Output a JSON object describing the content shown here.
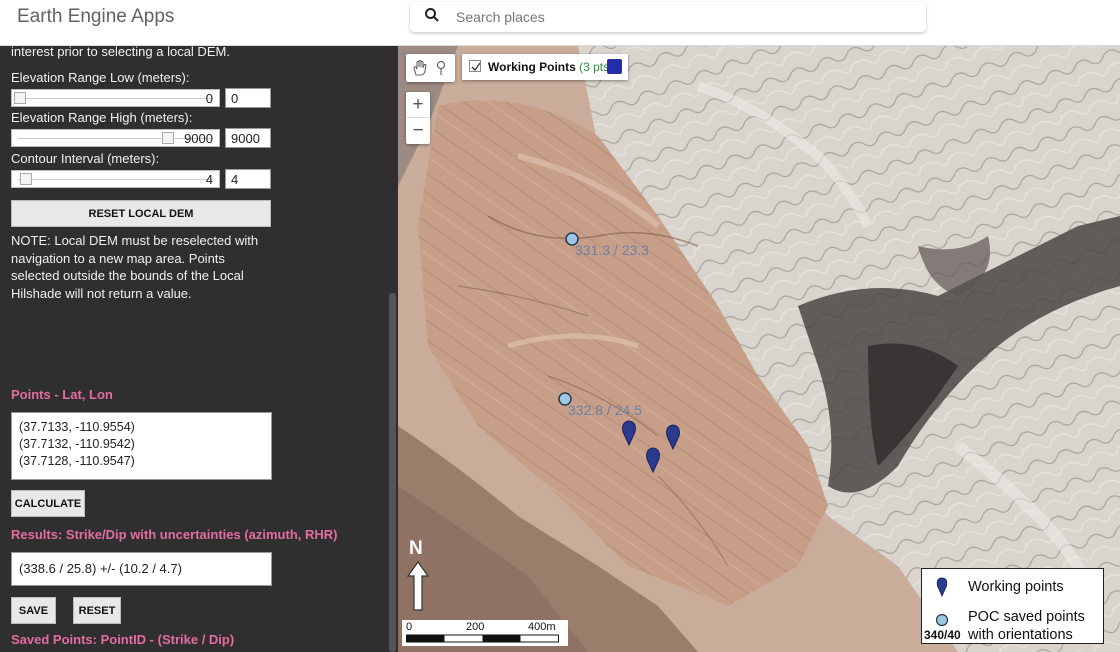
{
  "app_title": "Earth Engine Apps",
  "search": {
    "placeholder": "Search places"
  },
  "panel": {
    "intro_text": "interest prior to selecting a local DEM.",
    "elev_low": {
      "label": "Elevation Range Low (meters):",
      "slider_value": "0",
      "box_value": "0",
      "level": 0.0
    },
    "elev_high": {
      "label": "Elevation Range High (meters):",
      "slider_value": "9000",
      "box_value": "9000",
      "level": 1.0
    },
    "contour": {
      "label": "Contour Interval (meters):",
      "slider_value": "4",
      "box_value": "4",
      "level": 0.04
    },
    "reset_dem_label": "RESET LOCAL DEM",
    "note_lines": [
      "NOTE: Local DEM must be reselected with",
      "navigation to a new map area. Points",
      "selected outside the bounds of the Local",
      "Hilshade will not return a value."
    ],
    "points_heading": "Points - Lat, Lon",
    "points": [
      "(37.7133, -110.9554)",
      "(37.7132, -110.9542)",
      "(37.7128, -110.9547)"
    ],
    "calculate_label": "CALCULATE",
    "results_heading": "Results: Strike/Dip with uncertainties (azimuth, RHR)",
    "result_value": "(338.6 / 25.8) +/- (10.2 / 4.7)",
    "save_label": "SAVE",
    "reset_label": "RESET",
    "saved_heading": "Saved Points: PointID - (Strike / Dip)"
  },
  "map": {
    "layer": {
      "name": "Working Points",
      "count": "(3 pts)",
      "color": "#232da8"
    },
    "zoom_in": "+",
    "zoom_out": "−",
    "orientations": [
      "331.3 / 23.3",
      "332.8 / 24.5"
    ],
    "north_label": "N",
    "scale": {
      "ticks": [
        "0",
        "200",
        "400m"
      ]
    },
    "legend": {
      "working": "Working points",
      "poc_line1": "POC saved points",
      "poc_line2": "with orientations",
      "ratio": "340/40"
    },
    "colors": {
      "working_marker": "#2b3a8c",
      "poc_marker": "#9cc7e3"
    }
  }
}
